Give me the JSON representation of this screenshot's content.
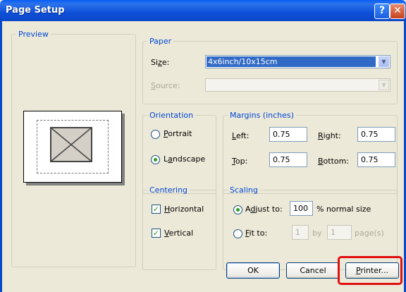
{
  "window": {
    "title": "Page Setup",
    "help": "?",
    "close": "✕"
  },
  "preview": {
    "label": "Preview"
  },
  "paper": {
    "label": "Paper",
    "size_label_pre": "Si",
    "size_label_u": "z",
    "size_label_post": "e:",
    "size_value": "4x6inch/10x15cm",
    "source_label_u": "S",
    "source_label_post": "ource:"
  },
  "orientation": {
    "label": "Orientation",
    "portrait_u": "P",
    "portrait_post": "ortrait",
    "landscape_pre": "L",
    "landscape_u": "a",
    "landscape_post": "ndscape",
    "selected": "Landscape"
  },
  "margins": {
    "label": "Margins (inches)",
    "left_u": "L",
    "left_post": "eft:",
    "left_value": "0.75",
    "right_u": "R",
    "right_post": "ight:",
    "right_value": "0.75",
    "top_u": "T",
    "top_post": "op:",
    "top_value": "0.75",
    "bottom_u": "B",
    "bottom_post": "ottom:",
    "bottom_value": "0.75"
  },
  "centering": {
    "label": "Centering",
    "horizontal_u": "H",
    "horizontal_post": "orizontal",
    "horizontal_checked": true,
    "vertical_u": "V",
    "vertical_post": "ertical",
    "vertical_checked": true
  },
  "scaling": {
    "label": "Scaling",
    "adjust_pre": "A",
    "adjust_u": "d",
    "adjust_post": "just to:",
    "adjust_value": "100",
    "adjust_suffix": "% normal size",
    "fit_u": "F",
    "fit_post": "it to:",
    "fit_w": "1",
    "fit_by": "by",
    "fit_h": "1",
    "fit_suffix": "page(s)"
  },
  "buttons": {
    "ok": "OK",
    "cancel": "Cancel",
    "printer_u": "P",
    "printer_post": "rinter..."
  },
  "colors": {
    "title_bar": "#0a5ef5",
    "group_label": "#0046d5",
    "highlight": "#e01010"
  }
}
